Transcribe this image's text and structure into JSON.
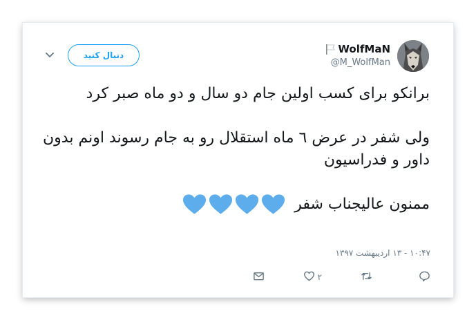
{
  "user": {
    "display_name": "WolfMaN",
    "handle": "@M_WolfMan",
    "avatar_icon": "wolf-avatar",
    "flag_icon": "white-flag-icon"
  },
  "follow_button": {
    "label": "دنبال کنید"
  },
  "tweet": {
    "paragraph_1": "برانکو برای کسب اولین جام دو سال و دو ماه صبر کرد",
    "paragraph_2": "ولی شفر در عرض ٦ ماه استقلال رو به جام رسوند اونم بدون داور و فدراسیون",
    "paragraph_3": "ممنون عالیجناب شفر",
    "emoji": [
      "blue-heart",
      "blue-heart",
      "blue-heart",
      "blue-heart"
    ],
    "timestamp": "۱۰:۴۷ - ۱۳ اردیبهشت ۱۳۹۷"
  },
  "actions": {
    "reply_icon": "reply-icon",
    "retweet_icon": "retweet-icon",
    "like_icon": "heart-icon",
    "like_count": "۲",
    "dm_icon": "envelope-icon"
  },
  "colors": {
    "accent": "#1da1f2",
    "text": "#14171a",
    "muted": "#657786",
    "heart_emoji": "#5dadec"
  }
}
